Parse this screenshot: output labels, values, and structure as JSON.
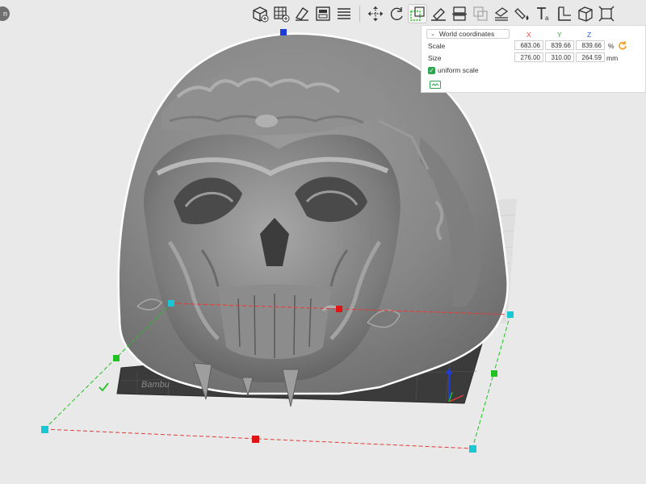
{
  "app": {
    "corner_chip_text": "n"
  },
  "toolbar": {
    "buttons": [
      {
        "name": "add-object-icon"
      },
      {
        "name": "arrange-grid-icon"
      },
      {
        "name": "orient-icon"
      },
      {
        "name": "lay-on-face-icon"
      },
      {
        "name": "split-parts-icon"
      },
      {
        "name": "separator"
      },
      {
        "name": "move-icon"
      },
      {
        "name": "rotate-icon"
      },
      {
        "name": "scale-icon",
        "active": true
      },
      {
        "name": "lay-on-surface-icon"
      },
      {
        "name": "cut-icon"
      },
      {
        "name": "boolean-icon",
        "disabled": true
      },
      {
        "name": "support-paint-icon"
      },
      {
        "name": "color-paint-icon"
      },
      {
        "name": "text-icon"
      },
      {
        "name": "measure-icon"
      },
      {
        "name": "assembly-icon"
      },
      {
        "name": "fit-view-icon"
      }
    ]
  },
  "scale_panel": {
    "coordinate_mode": "World coordinates",
    "axis_x": "X",
    "axis_y": "Y",
    "axis_z": "Z",
    "axis_colors": {
      "x": "#e53935",
      "y": "#43a047",
      "z": "#1e5bd8"
    },
    "scale_label": "Scale",
    "scale_x": "683.06",
    "scale_y": "839.66",
    "scale_z": "839.66",
    "scale_unit": "%",
    "size_label": "Size",
    "size_x": "276.00",
    "size_y": "310.00",
    "size_z": "264.59",
    "size_unit": "mm",
    "uniform_scale_label": "uniform scale",
    "uniform_scale_checked": true
  },
  "viewport": {
    "bed_logo_text": "Bambu",
    "accent_color": "#00c853",
    "gizmo_x_color": "#e53935",
    "gizmo_y_color": "#21c121",
    "gizmo_z_color": "#1e3cd8",
    "handle_color": "#19c6d4"
  }
}
